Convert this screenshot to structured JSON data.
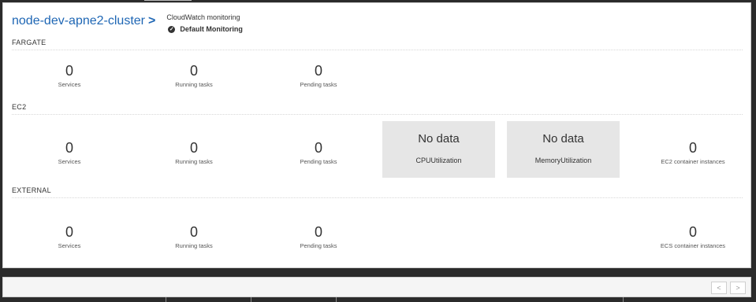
{
  "cluster": {
    "name": "node-dev-apne2-cluster",
    "arrow": ">",
    "cloudwatch_title": "CloudWatch monitoring",
    "cloudwatch_status": "Default Monitoring"
  },
  "sections": {
    "fargate": {
      "label": "FARGATE",
      "services": {
        "value": "0",
        "label": "Services"
      },
      "running": {
        "value": "0",
        "label": "Running tasks"
      },
      "pending": {
        "value": "0",
        "label": "Pending tasks"
      }
    },
    "ec2": {
      "label": "EC2",
      "services": {
        "value": "0",
        "label": "Services"
      },
      "running": {
        "value": "0",
        "label": "Running tasks"
      },
      "pending": {
        "value": "0",
        "label": "Pending tasks"
      },
      "cpu": {
        "text": "No data",
        "label": "CPUUtilization"
      },
      "memory": {
        "text": "No data",
        "label": "MemoryUtilization"
      },
      "instances": {
        "value": "0",
        "label": "EC2 container instances"
      }
    },
    "external": {
      "label": "EXTERNAL",
      "services": {
        "value": "0",
        "label": "Services"
      },
      "running": {
        "value": "0",
        "label": "Running tasks"
      },
      "pending": {
        "value": "0",
        "label": "Pending tasks"
      },
      "instances": {
        "value": "0",
        "label": "ECS container instances"
      }
    }
  },
  "pager": {
    "prev": "<",
    "next": ">"
  }
}
